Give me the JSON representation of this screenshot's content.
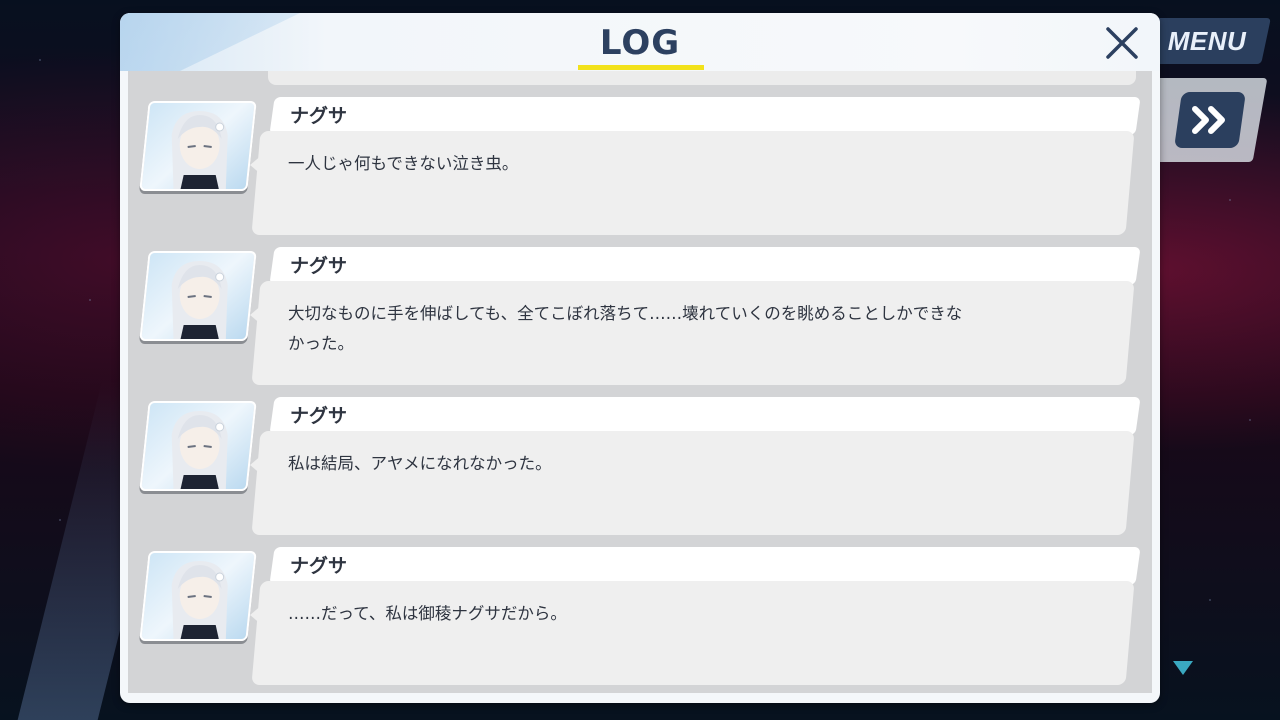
{
  "window": {
    "title": "LOG",
    "close_icon": "close-icon"
  },
  "side_controls": {
    "menu_label": "MENU",
    "fast_forward_icon": "fast-forward-icon",
    "scroll_down_icon": "triangle-down-icon"
  },
  "colors": {
    "title": "#2c4060",
    "underline": "#f2e21b",
    "button_bg": "#2b3f5e",
    "scroll_arrow": "#3aa8c0"
  },
  "entries": [
    {
      "speaker": "ナグサ",
      "text": "一人じゃ何もできない泣き虫。",
      "avatar_icon": "character-portrait-icon"
    },
    {
      "speaker": "ナグサ",
      "text": "大切なものに手を伸ばしても、全てこぼれ落ちて……壊れていくのを眺めることしかできな\nかった。",
      "avatar_icon": "character-portrait-icon"
    },
    {
      "speaker": "ナグサ",
      "text": "私は結局、アヤメになれなかった。",
      "avatar_icon": "character-portrait-icon"
    },
    {
      "speaker": "ナグサ",
      "text": "……だって、私は御稜ナグサだから。",
      "avatar_icon": "character-portrait-icon"
    }
  ]
}
